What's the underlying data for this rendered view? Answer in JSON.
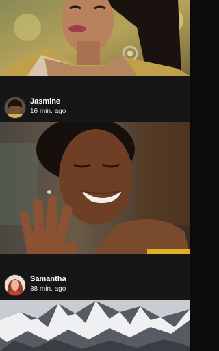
{
  "posts": [
    {
      "author": "",
      "time": "",
      "image": "portrait-woman-earring-photo"
    },
    {
      "author": "Jasmine",
      "time": "16 min. ago",
      "avatar": "jasmine-avatar",
      "image": "smiling-woman-hand-photo"
    },
    {
      "author": "Samantha",
      "time": "38 min. ago",
      "avatar": "samantha-avatar",
      "image": "snowy-mountain-photo"
    }
  ],
  "colors": {
    "background": "#161616",
    "text": "#ffffff"
  }
}
